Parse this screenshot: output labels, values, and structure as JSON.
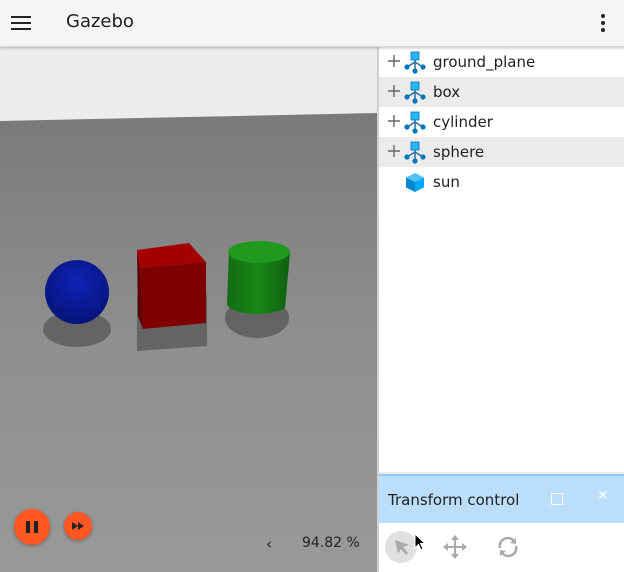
{
  "header": {
    "title": "Gazebo",
    "menu_icon": "hamburger-icon",
    "more_icon": "more-vert-icon"
  },
  "scene": {
    "colors": {
      "sky": "#ececec",
      "ground": "#8c8c8c",
      "sphere": "#0b1d9e",
      "box": "#8d0000",
      "cylinder": "#157a15"
    },
    "playback": {
      "pause_icon": "pause-icon",
      "step_icon": "fast-forward-icon"
    },
    "rtf_label": "94.82 %",
    "collapse_icon": "chevron-left-icon"
  },
  "entity_tree": {
    "items": [
      {
        "label": "ground_plane",
        "expandable": true,
        "icon": "model-icon"
      },
      {
        "label": "box",
        "expandable": true,
        "icon": "model-icon"
      },
      {
        "label": "cylinder",
        "expandable": true,
        "icon": "model-icon"
      },
      {
        "label": "sphere",
        "expandable": true,
        "icon": "model-icon"
      },
      {
        "label": "sun",
        "expandable": false,
        "icon": "light-cube-icon"
      }
    ]
  },
  "transform_control": {
    "title": "Transform control",
    "header_color": "#bbdefb",
    "tools": [
      {
        "icon": "select-arrow-icon",
        "active": true
      },
      {
        "icon": "translate-icon",
        "active": false
      },
      {
        "icon": "rotate-icon",
        "active": false
      }
    ]
  }
}
